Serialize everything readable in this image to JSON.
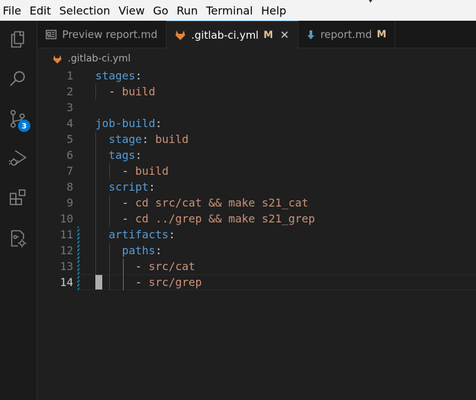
{
  "menu": [
    "File",
    "Edit",
    "Selection",
    "View",
    "Go",
    "Run",
    "Terminal",
    "Help"
  ],
  "activity_bar": {
    "items": [
      "explorer-icon",
      "search-icon",
      "source-control-icon",
      "run-debug-icon",
      "extensions-icon",
      "remote-explorer-icon"
    ],
    "source_control_badge": "3"
  },
  "tabs": [
    {
      "label": "Preview report.md",
      "icon": "preview-icon",
      "modified": "",
      "active": false
    },
    {
      "label": ".gitlab-ci.yml",
      "icon": "gitlab-icon",
      "modified": "M",
      "active": true,
      "close": "✕"
    },
    {
      "label": "report.md",
      "icon": "markdown-icon",
      "modified": "M",
      "active": false
    }
  ],
  "breadcrumb": {
    "file": ".gitlab-ci.yml",
    "icon": "gitlab-icon"
  },
  "editor": {
    "current_line": 14,
    "lines": [
      {
        "n": "1",
        "indent": "",
        "key": "stages",
        "sep": ":",
        "value": ""
      },
      {
        "n": "2",
        "indent": "  ",
        "key": "",
        "sep": "- ",
        "value": "build"
      },
      {
        "n": "3",
        "indent": "",
        "key": "",
        "sep": "",
        "value": ""
      },
      {
        "n": "4",
        "indent": "",
        "key": "job-build",
        "sep": ":",
        "value": ""
      },
      {
        "n": "5",
        "indent": "  ",
        "key": "stage",
        "sep": ": ",
        "value": "build"
      },
      {
        "n": "6",
        "indent": "  ",
        "key": "tags",
        "sep": ":",
        "value": ""
      },
      {
        "n": "7",
        "indent": "    ",
        "key": "",
        "sep": "- ",
        "value": "build"
      },
      {
        "n": "8",
        "indent": "  ",
        "key": "script",
        "sep": ":",
        "value": ""
      },
      {
        "n": "9",
        "indent": "    ",
        "key": "",
        "sep": "- ",
        "value": "cd src/cat && make s21_cat"
      },
      {
        "n": "10",
        "indent": "    ",
        "key": "",
        "sep": "- ",
        "value": "cd ../grep && make s21_grep"
      },
      {
        "n": "11",
        "indent": "  ",
        "key": "artifacts",
        "sep": ":",
        "value": ""
      },
      {
        "n": "12",
        "indent": "    ",
        "key": "paths",
        "sep": ":",
        "value": ""
      },
      {
        "n": "13",
        "indent": "      ",
        "key": "",
        "sep": "- ",
        "value": "src/cat"
      },
      {
        "n": "14",
        "indent": "      ",
        "key": "",
        "sep": "- ",
        "value": "src/grep"
      }
    ]
  }
}
